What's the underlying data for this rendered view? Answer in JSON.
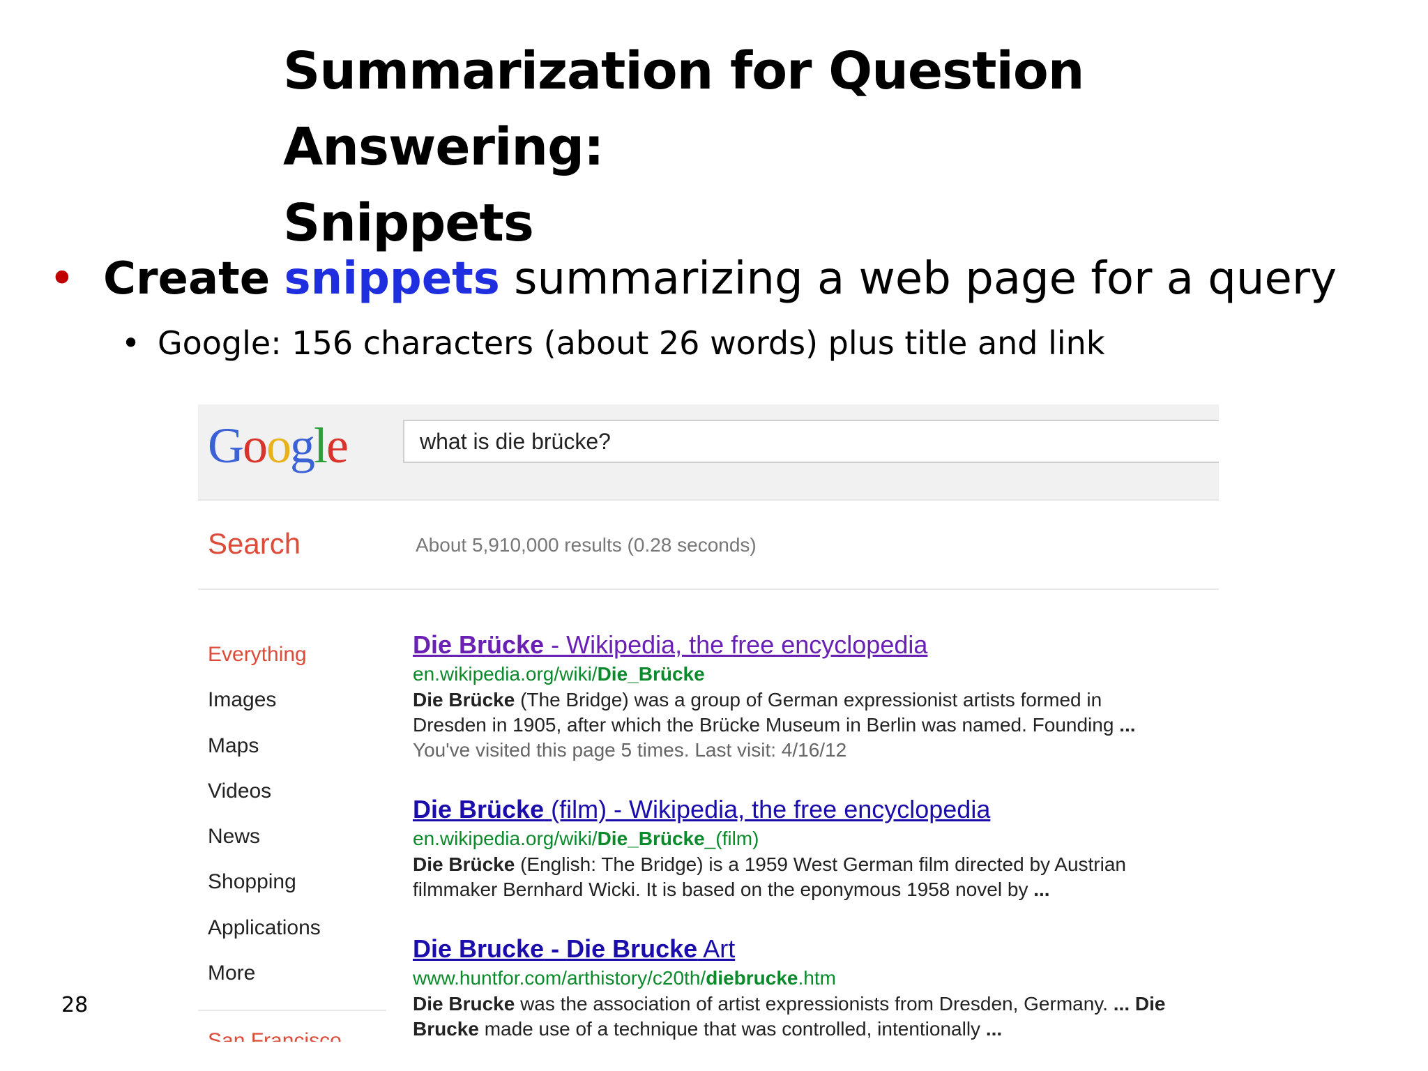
{
  "slide": {
    "title_line1": "Summarization for Question Answering:",
    "title_line2": "Snippets",
    "bullet_bold": "Create",
    "bullet_highlight": "snippets",
    "bullet_rest": "summarizing a web page for a query",
    "sub_bullet": "Google: 156 characters (about 26 words) plus title and link",
    "page_number": "28",
    "bullet_color": "#c00000",
    "highlight_color": "#1f2fe0"
  },
  "google": {
    "logo": [
      "G",
      "o",
      "o",
      "g",
      "l",
      "e"
    ],
    "query": "what is die brücke?",
    "search_label": "Search",
    "result_stats": "About 5,910,000 results (0.28 seconds)",
    "nav": [
      "Everything",
      "Images",
      "Maps",
      "Videos",
      "News",
      "Shopping",
      "Applications",
      "More"
    ],
    "nav_cut_off": "San Francisco",
    "results": [
      {
        "title_bold": "Die Brücke",
        "title_rest": " - Wikipedia, the free encyclopedia",
        "url_plain": "en.wikipedia.org/wiki/",
        "url_bold": "Die_Brücke",
        "url_tail": "",
        "snippet_line1_bold": "Die Brücke",
        "snippet_line1_rest": " (The Bridge) was a group of German expressionist artists formed in",
        "snippet_line2": "Dresden in 1905, after which the Brücke Museum in Berlin was named. Founding ",
        "snippet_line2_bold": "...",
        "visited": "You've visited this page 5 times. Last visit: 4/16/12"
      },
      {
        "title_bold": "Die Brücke",
        "title_rest": " (film) - Wikipedia, the free encyclopedia",
        "url_plain": "en.wikipedia.org/wiki/",
        "url_bold": "Die_Brücke",
        "url_tail": "_(film)",
        "snippet_line1_bold": "Die Brücke",
        "snippet_line1_rest": " (English: The Bridge) is a 1959 West German film directed by Austrian",
        "snippet_line2": "filmmaker Bernhard Wicki. It is based on the eponymous 1958 novel by ",
        "snippet_line2_bold": "..."
      },
      {
        "title_bold1": "Die Brucke",
        "title_mid": " - ",
        "title_bold2": "Die Brucke",
        "title_rest": " Art",
        "url_plain": "www.huntfor.com/arthistory/c20th/",
        "url_bold": "diebrucke",
        "url_tail": ".htm",
        "snippet_line1_bold": "Die Brucke",
        "snippet_line1_rest": " was the association of artist expressionists from Dresden, Germany. ",
        "snippet_line1_bold2": "... Die",
        "snippet_line2_bold": "Brucke",
        "snippet_line2_rest": " made use of a technique that was controlled, intentionally ",
        "snippet_line2_bold2": "..."
      }
    ],
    "colors": {
      "link": "#1a0dab",
      "visited_link": "#6a1fb5",
      "url": "#0a8a2a",
      "accent": "#dd4b39"
    }
  }
}
